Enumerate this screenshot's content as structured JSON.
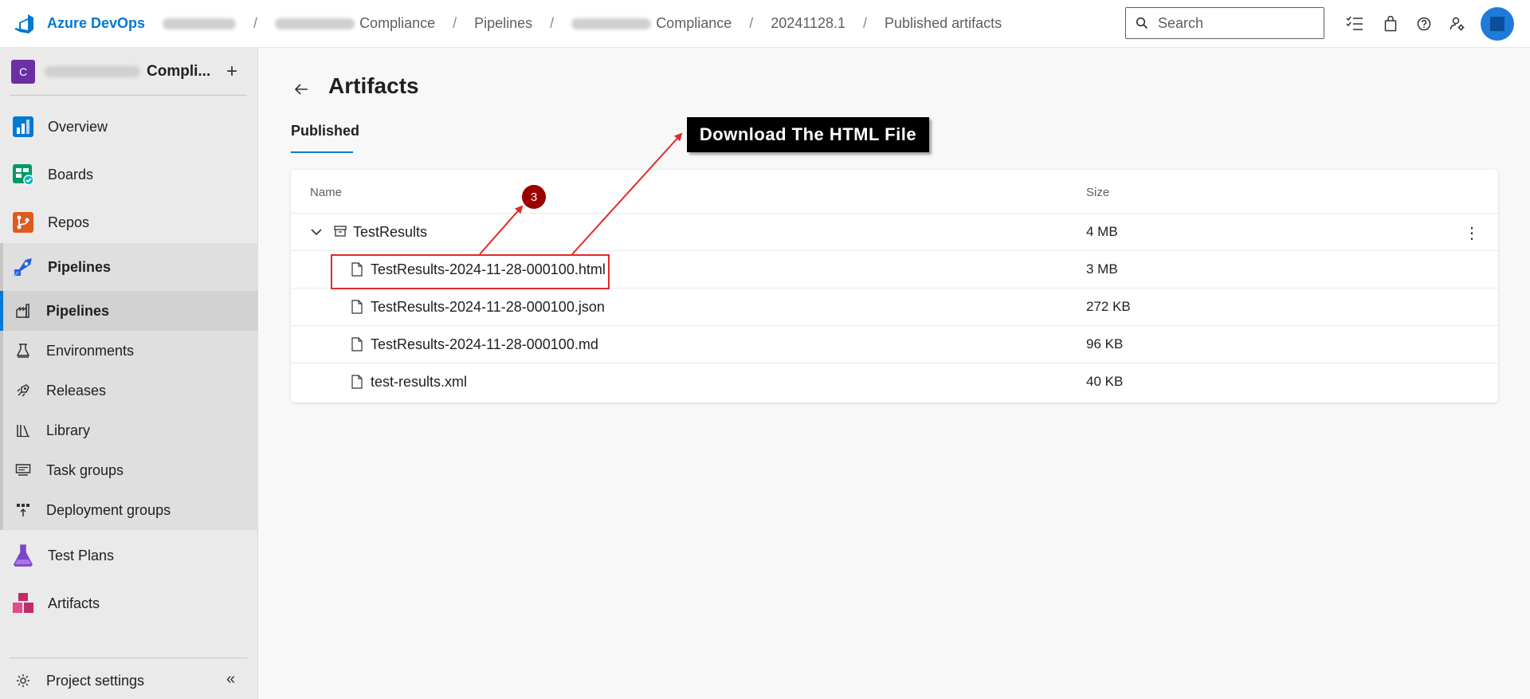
{
  "topbar": {
    "brand": "Azure DevOps",
    "breadcrumbs": [
      "Compliance",
      "Pipelines",
      "Compliance",
      "20241128.1",
      "Published artifacts"
    ],
    "search_placeholder": "Search"
  },
  "sidebar": {
    "project_initial": "C",
    "project_name": "Compli...",
    "items": [
      {
        "label": "Overview",
        "icon": "overview-icon"
      },
      {
        "label": "Boards",
        "icon": "boards-icon"
      },
      {
        "label": "Repos",
        "icon": "repos-icon"
      },
      {
        "label": "Pipelines",
        "icon": "pipelines-icon"
      }
    ],
    "sub_items": [
      {
        "label": "Pipelines",
        "icon": "pipelines-sub-icon"
      },
      {
        "label": "Environments",
        "icon": "environments-icon"
      },
      {
        "label": "Releases",
        "icon": "releases-icon"
      },
      {
        "label": "Library",
        "icon": "library-icon"
      },
      {
        "label": "Task groups",
        "icon": "task-groups-icon"
      },
      {
        "label": "Deployment groups",
        "icon": "deployment-groups-icon"
      }
    ],
    "bottom_items": [
      {
        "label": "Test Plans",
        "icon": "test-plans-icon"
      },
      {
        "label": "Artifacts",
        "icon": "artifacts-icon"
      }
    ],
    "settings_label": "Project settings"
  },
  "main": {
    "title": "Artifacts",
    "tab": "Published",
    "columns": {
      "name": "Name",
      "size": "Size"
    },
    "folder": {
      "name": "TestResults",
      "size": "4 MB"
    },
    "files": [
      {
        "name": "TestResults-2024-11-28-000100.html",
        "size": "3 MB"
      },
      {
        "name": "TestResults-2024-11-28-000100.json",
        "size": "272 KB"
      },
      {
        "name": "TestResults-2024-11-28-000100.md",
        "size": "96 KB"
      },
      {
        "name": "test-results.xml",
        "size": "40 KB"
      }
    ]
  },
  "annotation": {
    "label": "Download The HTML File",
    "step": "3"
  },
  "colors": {
    "accent": "#0078d4",
    "annotation_red": "#e32828",
    "step_badge": "#9b0000"
  }
}
